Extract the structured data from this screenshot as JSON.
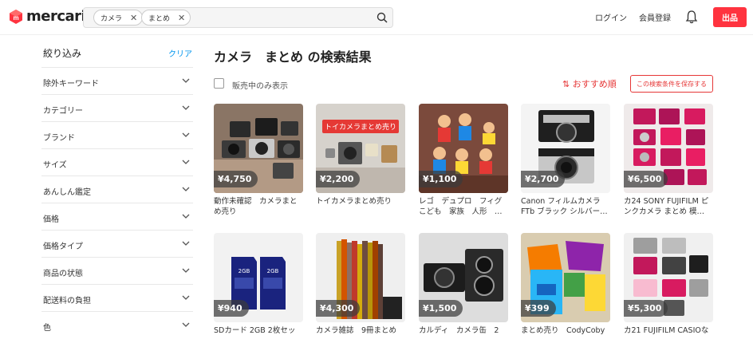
{
  "header": {
    "logo_text": "mercari",
    "chips": [
      {
        "label": "カメラ"
      },
      {
        "label": "まとめ"
      }
    ],
    "login": "ログイン",
    "signup": "会員登録",
    "sell": "出品"
  },
  "sidebar": {
    "title": "絞り込み",
    "clear": "クリア",
    "filters": [
      {
        "label": "除外キーワード"
      },
      {
        "label": "カテゴリー"
      },
      {
        "label": "ブランド"
      },
      {
        "label": "サイズ"
      },
      {
        "label": "あんしん鑑定"
      },
      {
        "label": "価格"
      },
      {
        "label": "価格タイプ"
      },
      {
        "label": "商品の状態"
      },
      {
        "label": "配送料の負担"
      },
      {
        "label": "色"
      }
    ]
  },
  "main": {
    "title": "カメラ　まとめ の検索結果",
    "sold_only_label": "販売中のみ表示",
    "sort_label": "⇅ おすすめ順",
    "save_search_label": "この検索条件を保存する",
    "items": [
      {
        "price": "¥4,750",
        "title": "動作未確認　カメラまとめ売り"
      },
      {
        "price": "¥2,200",
        "title": "トイカメラまとめ売り",
        "overlay": "トイカメラまとめ売り"
      },
      {
        "price": "¥1,100",
        "title": "レゴ　デュプロ　フィグ　こども　家族　人形　…"
      },
      {
        "price": "¥2,700",
        "title": "Canon フィルムカメラ FTb ブラック シルバー…"
      },
      {
        "price": "¥6,500",
        "title": "カ24 SONY FUJIFILM ピンクカメラ まとめ 模…"
      },
      {
        "price": "¥940",
        "title": "SDカード 2GB 2枚セッ"
      },
      {
        "price": "¥4,300",
        "title": "カメラ雑誌　9冊まとめ"
      },
      {
        "price": "¥1,500",
        "title": "カルディ　カメラ缶　2"
      },
      {
        "price": "¥399",
        "title": "まとめ売り　CodyCoby"
      },
      {
        "price": "¥5,300",
        "title": "カ21 FUJIFILM CASIOな"
      }
    ],
    "sd_label": "2GB"
  },
  "colors": {
    "brand_red": "#ff333f",
    "accent_red": "#e63737",
    "link_blue": "#0095ee"
  }
}
